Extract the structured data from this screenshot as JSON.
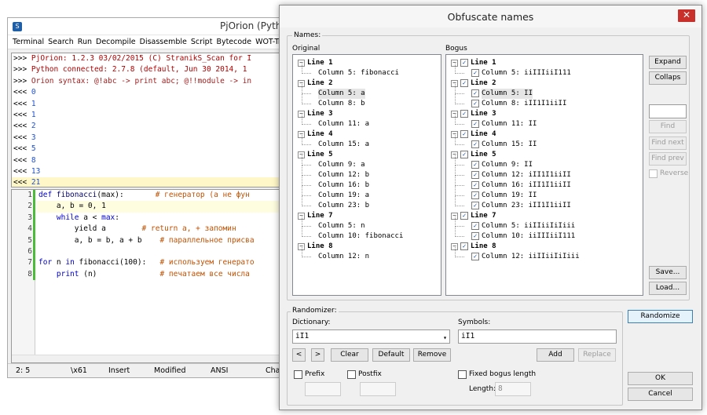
{
  "ide": {
    "title": "PjOrion (Pyth",
    "menu": [
      "Terminal",
      "Search",
      "Run",
      "Decompile",
      "Disassemble",
      "Script",
      "Bytecode",
      "WOT-Trans"
    ],
    "console_header": [
      ">>> ",
      "PjOrion: 1.2.3 03/02/2015 (C) StranikS_Scan for I"
    ],
    "console_lines": [
      {
        "p": ">>> ",
        "t": "PjOrion: 1.2.3 03/02/2015 (C) StranikS_Scan for I",
        "c": "c-head"
      },
      {
        "p": ">>> ",
        "t": "Python connected: 2.7.8 (default, Jun 30 2014, 1",
        "c": "c-head"
      },
      {
        "p": ">>> ",
        "t": "Orion syntax: @!abc -> print abc; @!!module -> in",
        "c": "c-orion"
      },
      {
        "p": "<<< ",
        "t": "0",
        "c": "c-out"
      },
      {
        "p": "<<< ",
        "t": "1",
        "c": "c-out"
      },
      {
        "p": "<<< ",
        "t": "1",
        "c": "c-out"
      },
      {
        "p": "<<< ",
        "t": "2",
        "c": "c-out"
      },
      {
        "p": "<<< ",
        "t": "3",
        "c": "c-out"
      },
      {
        "p": "<<< ",
        "t": "5",
        "c": "c-out"
      },
      {
        "p": "<<< ",
        "t": "8",
        "c": "c-out"
      },
      {
        "p": "<<< ",
        "t": "13",
        "c": "c-out"
      },
      {
        "p": "<<< ",
        "t": "21",
        "c": "c-out"
      }
    ],
    "line_numbers": [
      "1",
      "2",
      "3",
      "4",
      "5",
      "6",
      "7",
      "8"
    ],
    "code": {
      "l1a": "def ",
      "l1b": "fibonacci",
      "l1c": "(max):",
      "l1d": "       # генератор (а не фун",
      "l2": "    a, b = 0, 1",
      "l3a": "    ",
      "l3b": "while",
      "l3c": " a < ",
      "l3d": "max",
      "l3e": ":",
      "l4a": "        yield a",
      "l4b": "        # return a, + запомин",
      "l5a": "        a, b = b, a + b",
      "l5b": "    # параллельное присва",
      "l6": "",
      "l7a": "for",
      "l7b": " n ",
      "l7c": "in",
      "l7d": " fibonacci(100):",
      "l7e": "   # используем генерато",
      "l8a": "    ",
      "l8b": "print",
      "l8c": " (n)",
      "l8d": "              # печатаем все числа"
    },
    "status": {
      "pos": "2: 5",
      "char": "\\x61",
      "mode": "Insert",
      "modified": "Modified",
      "encoding": "ANSI",
      "extra": "Cha"
    }
  },
  "dialog": {
    "title": "Obfuscate names",
    "close": "✕",
    "names_group": "Names:",
    "original_label": "Original",
    "bogus_label": "Bogus",
    "original_tree": [
      {
        "t": "Line 1",
        "lvl": 0
      },
      {
        "t": "Column 5: fibonacci",
        "lvl": 1
      },
      {
        "t": "Line 2",
        "lvl": 0
      },
      {
        "t": "Column 5: a",
        "lvl": 1,
        "sel": true
      },
      {
        "t": "Column 8: b",
        "lvl": 1
      },
      {
        "t": "Line 3",
        "lvl": 0
      },
      {
        "t": "Column 11: a",
        "lvl": 1
      },
      {
        "t": "Line 4",
        "lvl": 0
      },
      {
        "t": "Column 15: a",
        "lvl": 1
      },
      {
        "t": "Line 5",
        "lvl": 0
      },
      {
        "t": "Column 9: a",
        "lvl": 1
      },
      {
        "t": "Column 12: b",
        "lvl": 1
      },
      {
        "t": "Column 16: b",
        "lvl": 1
      },
      {
        "t": "Column 19: a",
        "lvl": 1
      },
      {
        "t": "Column 23: b",
        "lvl": 1
      },
      {
        "t": "Line 7",
        "lvl": 0
      },
      {
        "t": "Column 5: n",
        "lvl": 1
      },
      {
        "t": "Column 10: fibonacci",
        "lvl": 1
      },
      {
        "t": "Line 8",
        "lvl": 0
      },
      {
        "t": "Column 12: n",
        "lvl": 1
      }
    ],
    "bogus_tree": [
      {
        "t": "Line 1",
        "lvl": 0
      },
      {
        "t": "Column 5: iiIIIiiI111",
        "lvl": 1
      },
      {
        "t": "Line 2",
        "lvl": 0
      },
      {
        "t": "Column 5: II",
        "lvl": 1,
        "sel": true
      },
      {
        "t": "Column 8: iII1I1iiII",
        "lvl": 1
      },
      {
        "t": "Line 3",
        "lvl": 0
      },
      {
        "t": "Column 11: II",
        "lvl": 1
      },
      {
        "t": "Line 4",
        "lvl": 0
      },
      {
        "t": "Column 15: II",
        "lvl": 1
      },
      {
        "t": "Line 5",
        "lvl": 0
      },
      {
        "t": "Column 9: II",
        "lvl": 1
      },
      {
        "t": "Column 12: iII1I1iiII",
        "lvl": 1
      },
      {
        "t": "Column 16: iII1I1iiII",
        "lvl": 1
      },
      {
        "t": "Column 19: II",
        "lvl": 1
      },
      {
        "t": "Column 23: iII1I1iiII",
        "lvl": 1
      },
      {
        "t": "Line 7",
        "lvl": 0
      },
      {
        "t": "Column 5: iiIIiiIiIiii",
        "lvl": 1
      },
      {
        "t": "Column 10: iiIIIiiI111",
        "lvl": 1
      },
      {
        "t": "Line 8",
        "lvl": 0
      },
      {
        "t": "Column 12: iiIIiiIiIiii",
        "lvl": 1
      }
    ],
    "buttons": {
      "expand": "Expand",
      "collapse": "Collaps",
      "find": "Find",
      "find_next": "Find next",
      "find_prev": "Find prev",
      "reverse": "Reverse",
      "save": "Save...",
      "load": "Load...",
      "randomize": "Randomize",
      "prev": "<",
      "next": ">",
      "clear": "Clear",
      "default": "Default",
      "remove": "Remove",
      "add": "Add",
      "replace": "Replace",
      "ok": "OK",
      "cancel": "Cancel"
    },
    "randomizer_group": "Randomizer:",
    "dictionary_label": "Dictionary:",
    "dictionary_value": "iI1",
    "symbols_label": "Symbols:",
    "symbols_value": "iI1",
    "prefix_label": "Prefix",
    "postfix_label": "Postfix",
    "fixed_label": "Fixed bogus length",
    "length_label": "Length:",
    "length_value": "8",
    "check_mark": "✓"
  }
}
